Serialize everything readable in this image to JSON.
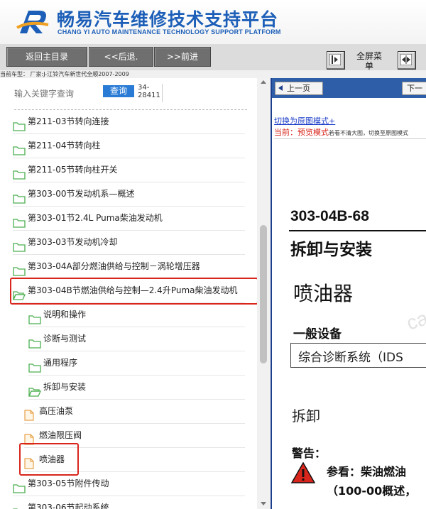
{
  "header": {
    "title": "畅易汽车维修技术支持平台",
    "subtitle": "CHANG YI AUTO MAINTENANCE TECHNOLOGY SUPPORT PLATFORM"
  },
  "toolbar": {
    "home_label": "返回主目录",
    "back_label": "<<后退.",
    "forward_label": ">>前进",
    "fullscreen_label": "全屏菜单"
  },
  "vehicle_info": "当前车型： 厂家:J-江铃汽车新世代全顺2007-2009",
  "search": {
    "placeholder": "输入关键字查询",
    "button_label": "查询",
    "page_code": "34-28411"
  },
  "tree": [
    {
      "label": "第211-03节转向连接",
      "icon": "folder-icon",
      "level": 0
    },
    {
      "label": "第211-04节转向柱",
      "icon": "folder-icon",
      "level": 0
    },
    {
      "label": "第211-05节转向柱开关",
      "icon": "folder-icon",
      "level": 0
    },
    {
      "label": "第303-00节发动机系—概述",
      "icon": "folder-icon",
      "level": 0
    },
    {
      "label": "第303-01节2.4L Puma柴油发动机",
      "icon": "folder-icon",
      "level": 0
    },
    {
      "label": "第303-03节发动机冷却",
      "icon": "folder-icon",
      "level": 0
    },
    {
      "label": "第303-04A部分燃油供给与控制－涡轮增压器",
      "icon": "folder-icon",
      "level": 0
    },
    {
      "label": "第303-04B节燃油供给与控制—2.4升Puma柴油发动机",
      "icon": "folder-open-icon",
      "level": 0,
      "highlighted": true
    },
    {
      "label": "说明和操作",
      "icon": "folder-icon",
      "level": 1
    },
    {
      "label": "诊断与测试",
      "icon": "folder-icon",
      "level": 1
    },
    {
      "label": "通用程序",
      "icon": "folder-icon",
      "level": 1
    },
    {
      "label": "拆卸与安装",
      "icon": "folder-open-icon",
      "level": 1
    },
    {
      "label": "高压油泵",
      "icon": "document-icon",
      "level": 2
    },
    {
      "label": "燃油限压阀",
      "icon": "document-icon",
      "level": 2
    },
    {
      "label": "喷油器",
      "icon": "document-icon",
      "level": 2,
      "highlighted": true
    },
    {
      "label": "第303-05节附件传动",
      "icon": "folder-icon",
      "level": 0
    },
    {
      "label": "第303-06节起动系统",
      "icon": "folder-icon",
      "level": 0
    }
  ],
  "viewer": {
    "prev_label": "上一页",
    "next_label": "下一",
    "switch_link": "切换为原图模式+",
    "current_label": "当前：",
    "current_mode": "预览模式",
    "current_hint": "若看不清大图，切换至原图模式",
    "doc": {
      "code": "303-04B-68",
      "section": "拆卸与安装",
      "part": "喷油器",
      "watermark": "ca",
      "equipment_title": "一般设备",
      "equipment_item": "综合诊断系统（IDS",
      "removal": "拆卸",
      "warning_title": "警告：",
      "warning_line1": "参看：柴油燃油",
      "warning_line2": "（100-00概述，"
    }
  },
  "colors": {
    "brand_blue": "#1d5fb8",
    "highlight_red": "#d9261c",
    "folder_green": "#4caf50",
    "document_orange": "#e7a24a",
    "viewer_bar": "#2f5ea8"
  }
}
